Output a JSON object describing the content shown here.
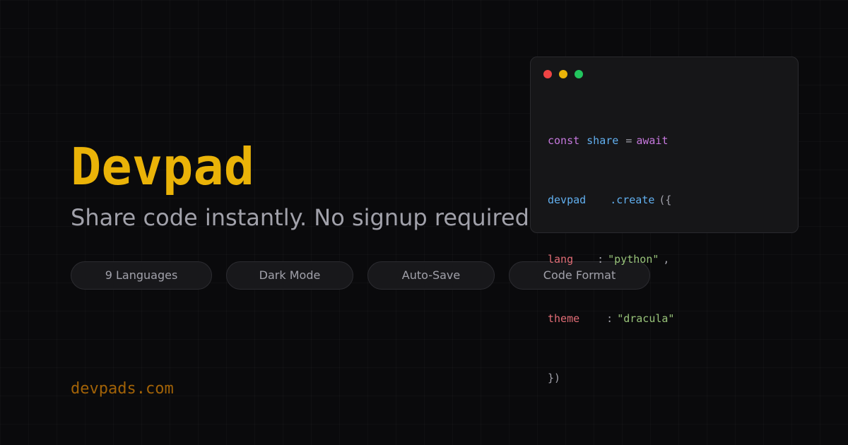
{
  "brand": {
    "title": "Devpad",
    "tagline": "Share code instantly. No signup required.",
    "domain": "devpads.com",
    "accent_color": "#eab308"
  },
  "features": [
    "9 Languages",
    "Dark Mode",
    "Auto-Save",
    "Code Format"
  ],
  "code_window": {
    "traffic_lights": [
      {
        "icon": "close-dot-icon",
        "color": "#ef4444"
      },
      {
        "icon": "minimize-dot-icon",
        "color": "#eab308"
      },
      {
        "icon": "maximize-dot-icon",
        "color": "#22c55e"
      }
    ],
    "line1": {
      "kw1": "const",
      "var": "share",
      "op": "=",
      "kw2": "await"
    },
    "line2": {
      "obj": "devpad",
      "method": ".create",
      "open": "({"
    },
    "line3": {
      "key": "lang",
      "colon": ":",
      "value": "\"python\"",
      "comma": ","
    },
    "line4": {
      "key": "theme",
      "colon": ":",
      "value": "\"dracula\""
    },
    "line5": {
      "close": "})"
    }
  }
}
